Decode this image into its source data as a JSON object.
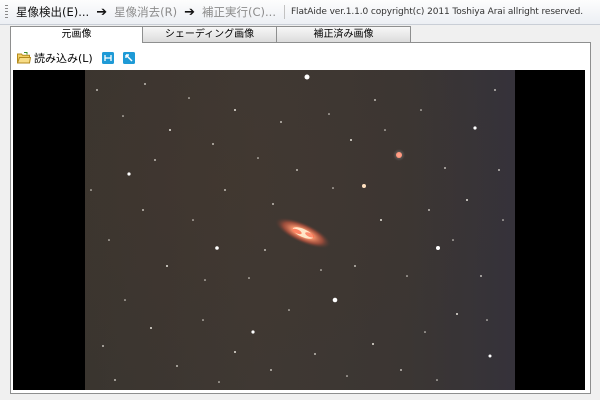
{
  "menubar": {
    "items": [
      {
        "label": "星像検出(E)...",
        "enabled": true
      },
      {
        "label": "星像消去(R)",
        "enabled": false
      },
      {
        "label": "補正実行(C)...",
        "enabled": false
      }
    ],
    "arrow": "➔",
    "info": "FlatAide ver.1.1.0  copyright(c) 2011 Toshiya Arai allright reserved."
  },
  "tabs": [
    {
      "label": "元画像",
      "active": true
    },
    {
      "label": "シェーディング画像",
      "active": false
    },
    {
      "label": "補正済み画像",
      "active": false
    }
  ],
  "toolbar": {
    "load_label": "読み込み(L)",
    "icons": [
      "folder-icon",
      "fit-icon",
      "zoom-icon"
    ]
  },
  "colors": {
    "accent": "#1e9ad6",
    "folder": "#e8b93a",
    "sky_background": "#3c3631",
    "viewer_background": "#000000"
  }
}
